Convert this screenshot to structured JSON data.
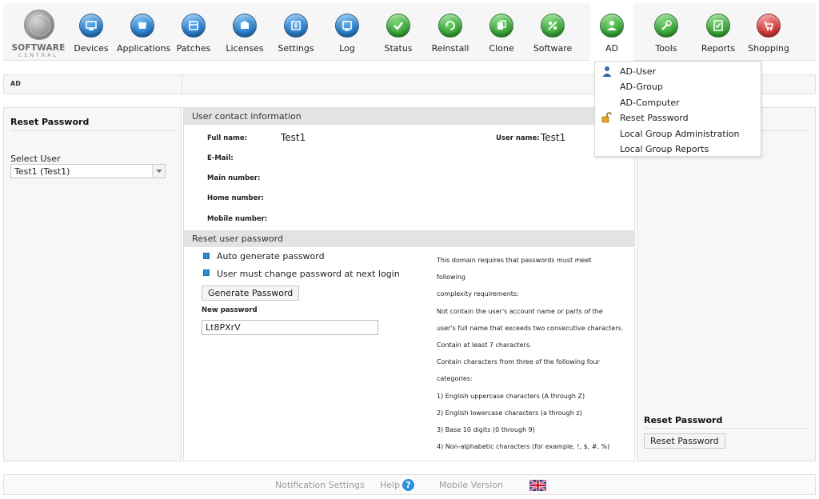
{
  "brand": {
    "line1": "SOFTWARE",
    "line2": "CENTRAL"
  },
  "nav": {
    "items": [
      {
        "label": "Devices",
        "icon": "devices-icon",
        "color": "blue"
      },
      {
        "label": "Applications",
        "icon": "applications-icon",
        "color": "blue"
      },
      {
        "label": "Patches",
        "icon": "patches-icon",
        "color": "blue"
      },
      {
        "label": "Licenses",
        "icon": "licenses-icon",
        "color": "blue"
      },
      {
        "label": "Settings",
        "icon": "settings-icon",
        "color": "blue"
      },
      {
        "label": "Log",
        "icon": "log-icon",
        "color": "blue"
      },
      {
        "label": "Status",
        "icon": "status-icon",
        "color": "green"
      },
      {
        "label": "Reinstall",
        "icon": "reinstall-icon",
        "color": "green"
      },
      {
        "label": "Clone",
        "icon": "clone-icon",
        "color": "green"
      },
      {
        "label": "Software",
        "icon": "software-icon",
        "color": "green"
      },
      {
        "label": "AD",
        "icon": "ad-icon",
        "color": "green",
        "active": true
      },
      {
        "label": "Tools",
        "icon": "tools-icon",
        "color": "green"
      },
      {
        "label": "Reports",
        "icon": "reports-icon",
        "color": "green"
      },
      {
        "label": "Shopping",
        "icon": "shopping-icon",
        "color": "red"
      }
    ]
  },
  "breadcrumb": {
    "text": "AD"
  },
  "ad_menu": {
    "items": [
      {
        "label": "AD-User",
        "icon": "user-icon"
      },
      {
        "label": "AD-Group",
        "icon": ""
      },
      {
        "label": "AD-Computer",
        "icon": ""
      },
      {
        "label": "Reset Password",
        "icon": "padlock-icon"
      },
      {
        "label": "Local Group Administration",
        "icon": ""
      },
      {
        "label": "Local Group Reports",
        "icon": ""
      }
    ]
  },
  "left": {
    "title": "Reset Password",
    "select_label": "Select User",
    "select_value": "Test1 (Test1)"
  },
  "contact": {
    "section_title": "User contact information",
    "full_name_label": "Full name:",
    "full_name_value": "Test1",
    "user_name_label": "User name:",
    "user_name_value": "Test1",
    "email_label": "E-Mail:",
    "main_number_label": "Main number:",
    "home_number_label": "Home number:",
    "mobile_number_label": "Mobile number:"
  },
  "reset": {
    "section_title": "Reset user password",
    "auto_generate_label": "Auto generate password",
    "auto_generate_checked": true,
    "must_change_label": "User must change password at next login",
    "must_change_checked": true,
    "generate_button": "Generate Password",
    "new_password_label": "New password",
    "new_password_value": "Lt8PXrV",
    "requirements": [
      "This domain requires that passwords must meet",
      "following",
      "complexity requirements:",
      "Not contain the user's account name or parts of the",
      "user's full name that exceeds two consecutive characters.",
      "Contain at least 7 characters.",
      "Contain characters from three of the following four",
      "categories:",
      "1) English uppercase characters (A through Z)",
      "2) English lowercase characters (a through z)",
      "3) Base 10 digits (0 through 9)",
      "4) Non-alphabetic characters (for example, !, $, #, %)"
    ]
  },
  "right": {
    "title": "Reset Password",
    "button": "Reset Password"
  },
  "footer": {
    "notification_settings": "Notification Settings",
    "help": "Help",
    "help_icon_glyph": "?",
    "mobile_version": "Mobile Version",
    "language_icon": "uk-flag-icon"
  },
  "colors": {
    "accent_blue": "#2a7fcd",
    "accent_green": "#3aa83a",
    "accent_red": "#d43b3b",
    "checkbox": "#2b8fd6",
    "section_bar": "#e3e3e3"
  }
}
